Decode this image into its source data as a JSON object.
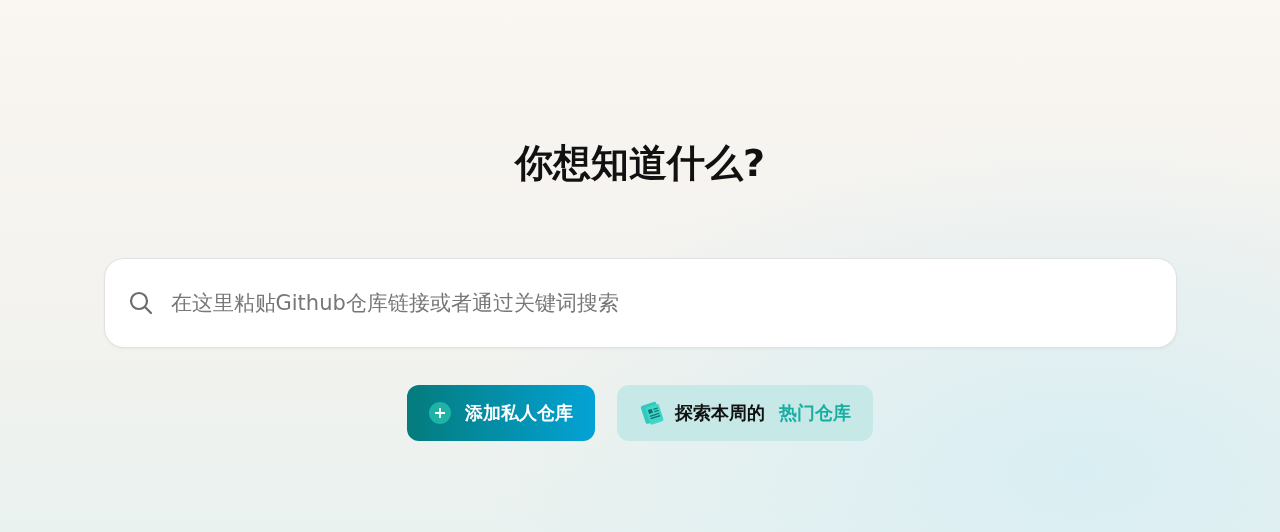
{
  "heading": "你想知道什么?",
  "search": {
    "placeholder": "在这里粘贴Github仓库链接或者通过关键词搜索"
  },
  "actions": [
    {
      "kind": "primary",
      "label": "添加私人仓库"
    },
    {
      "kind": "secondary",
      "label": "探索本周的",
      "highlight": "热门仓库"
    }
  ]
}
